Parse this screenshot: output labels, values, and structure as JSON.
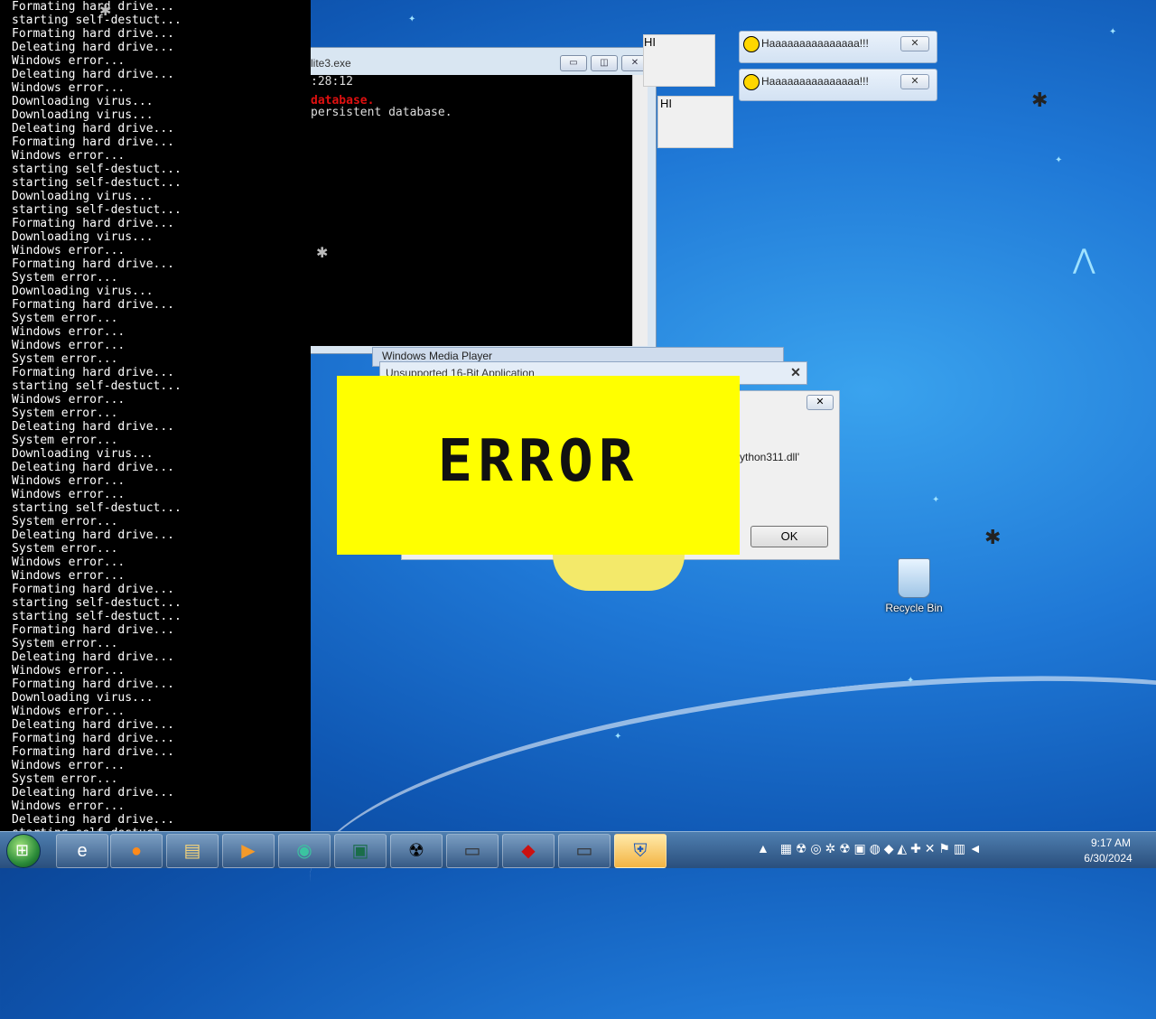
{
  "console": {
    "lines": [
      "Formating hard drive...",
      "starting self-destuct...",
      "Formating hard drive...",
      "Deleating hard drive...",
      "Windows error...",
      "Deleating hard drive...",
      "Windows error...",
      "Downloading virus...",
      "Downloading virus...",
      "Deleating hard drive...",
      "Formating hard drive...",
      "Windows error...",
      "starting self-destuct...",
      "starting self-destuct...",
      "Downloading virus...",
      "starting self-destuct...",
      "Formating hard drive...",
      "Downloading virus...",
      "Windows error...",
      "Formating hard drive...",
      "System error...",
      "Downloading virus...",
      "Formating hard drive...",
      "System error...",
      "Windows error...",
      "Windows error...",
      "System error...",
      "Formating hard drive...",
      "starting self-destuct...",
      "Windows error...",
      "System error...",
      "Deleating hard drive...",
      "System error...",
      "Downloading virus...",
      "Deleating hard drive...",
      "Windows error...",
      "Windows error...",
      "starting self-destuct...",
      "System error...",
      "Deleating hard drive...",
      "System error...",
      "Windows error...",
      "Windows error...",
      "Formating hard drive...",
      "starting self-destuct...",
      "starting self-destuct...",
      "Formating hard drive...",
      "System error...",
      "Deleating hard drive...",
      "Windows error...",
      "Formating hard drive...",
      "Downloading virus...",
      "Windows error...",
      "Deleating hard drive...",
      "Formating hard drive...",
      "Formating hard drive...",
      "Windows error...",
      "System error...",
      "Deleating hard drive...",
      "Windows error...",
      "Deleating hard drive...",
      "starting self-destuct..."
    ]
  },
  "window2": {
    "title": "lite3.exe",
    "line1": ":28:12",
    "line2": "database.",
    "line3": " persistent database."
  },
  "hi_boxes": [
    "HI",
    "HI"
  ],
  "haa_dialogs": [
    {
      "title": "Haaaaaaaaaaaaaaa!!!"
    },
    {
      "title": "Haaaaaaaaaaaaaaa!!!"
    }
  ],
  "wmp_title": "Windows Media Player",
  "unsupported_title": "Unsupported 16-Bit Application",
  "dll_dialog": {
    "text": "ython311.dll'",
    "ok_label": "OK"
  },
  "error_panel": {
    "text": "ERROR"
  },
  "desktop": {
    "recycle_bin_label": "Recycle Bin"
  },
  "taskbar": {
    "time": "9:17 AM",
    "date": "6/30/2024"
  }
}
